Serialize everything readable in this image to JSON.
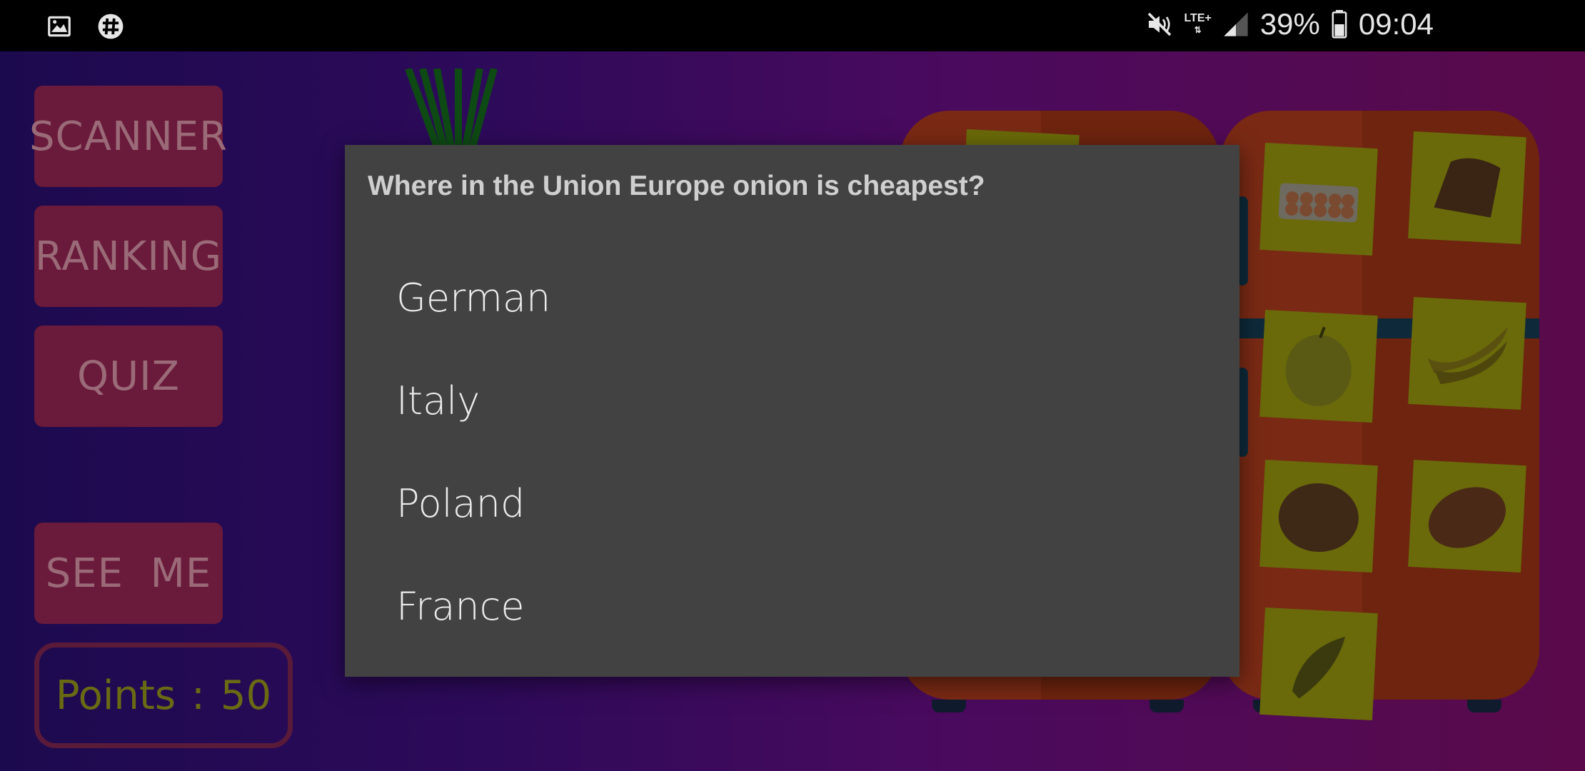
{
  "status_bar": {
    "battery_percent": "39%",
    "time": "09:04",
    "network": "LTE+",
    "icons": [
      "image-icon",
      "hashtag-icon",
      "mute-icon",
      "signal-icon",
      "battery-icon"
    ]
  },
  "menu": {
    "scanner": "SCANNER",
    "ranking": "RANKING",
    "quiz": "QUIZ",
    "see_me": "SEE  ME"
  },
  "points": {
    "label": "Points",
    "separator": ":",
    "value": "50"
  },
  "fridge_items": [
    "eggs-icon",
    "bread-loaf-icon",
    "apple-icon",
    "banana-icon",
    "roll-icon",
    "brown-bread-icon",
    "cucumber-icon"
  ],
  "dialog": {
    "question": "Where in the Union Europe onion is cheapest?",
    "options": [
      "German",
      "Italy",
      "Poland",
      "France"
    ]
  },
  "colors": {
    "dialog_bg": "#424242",
    "menu_button": "#6a1a3a",
    "fridge": "#7a2a14"
  }
}
